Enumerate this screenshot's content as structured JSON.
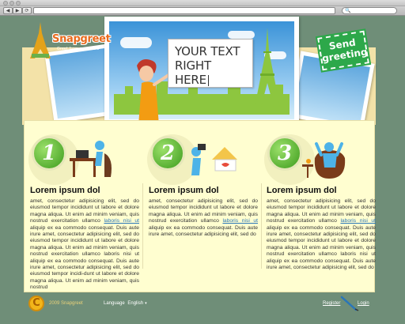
{
  "browser": {
    "back_glyph": "◀",
    "forward_glyph": "▶",
    "reload_glyph": "⟳",
    "search_glyph": "🔍",
    "address": "",
    "search_value": ""
  },
  "brand": {
    "name": "Snapgreet",
    "tagline": "Greet from anywhere",
    "accent": "#e96a1c",
    "green": "#2da84a"
  },
  "hero": {
    "speech_line1": "YOUR TEXT",
    "speech_line2": "RIGHT HERE",
    "stamp_line1": "Send",
    "stamp_line2": "greeting"
  },
  "steps": [
    {
      "number": "1",
      "title": "Lorem ipsum dol",
      "text_before_link": "amet, consectetur adipisicing elit, sed do eiusmod tempor incididunt ut labore et dolore magna aliqua. Ut enim ad minim veniam, quis nostrud exercitation ullamco ",
      "link": "laboris nisi ut",
      "text_after_link": " aliquip ex ea commodo consequat. Duis aute irure amet, consectetur adipisicing elit, sed do eiusmod tempor incididunt ut labore et dolore magna aliqua. Ut enim ad minim veniam, quis nostrud exercitation ullamco laboris nisi ut aliquip ex ea commodo consequat. Duis aute irure amet, consectetur adipisicing elit, sed do eiusmod tempor incidi-dunt ut labore et dolore magna aliqua. Ut enim ad minim veniam, quis nostrud"
    },
    {
      "number": "2",
      "title": "Lorem ipsum dol",
      "text_before_link": "amet, consectetur adipisicing elit, sed do eiusmod tempor incididunt ut labore et dolore magna aliqua. Ut enim ad minim veniam, quis nostrud exercitation ullamco ",
      "link": "laboris nisi ut",
      "text_after_link": " aliquip ex ea commodo consequat. Duis aute irure amet, consectetur adipisicing elit, sed do"
    },
    {
      "number": "3",
      "title": "Lorem ipsum dol",
      "text_before_link": "amet, consectetur adipisicing elit, sed do eiusmod tempor incididunt ut labore et dolore magna aliqua. Ut enim ad minim veniam, quis nostrud exercitation ullamco ",
      "link": "laboris nisi ut",
      "text_after_link": " aliquip ex ea commodo consequat. Duis aute irure amet, consectetur adipisicing elit, sed do eiusmod tempor incididunt ut labore et dolore magna aliqua. Ut enim ad minim veniam, quis nostrud exercitation ullamco laboris nisi ut aliquip ex ea commodo consequat. Duis aute irure amet, consectetur adipisicing elit, sed do"
    }
  ],
  "footer": {
    "copyright_symbol": "C",
    "copyright_text": "2009 Snapgreet",
    "language_label": "Language",
    "language_value": "English",
    "register": "Register",
    "login": "Login"
  }
}
